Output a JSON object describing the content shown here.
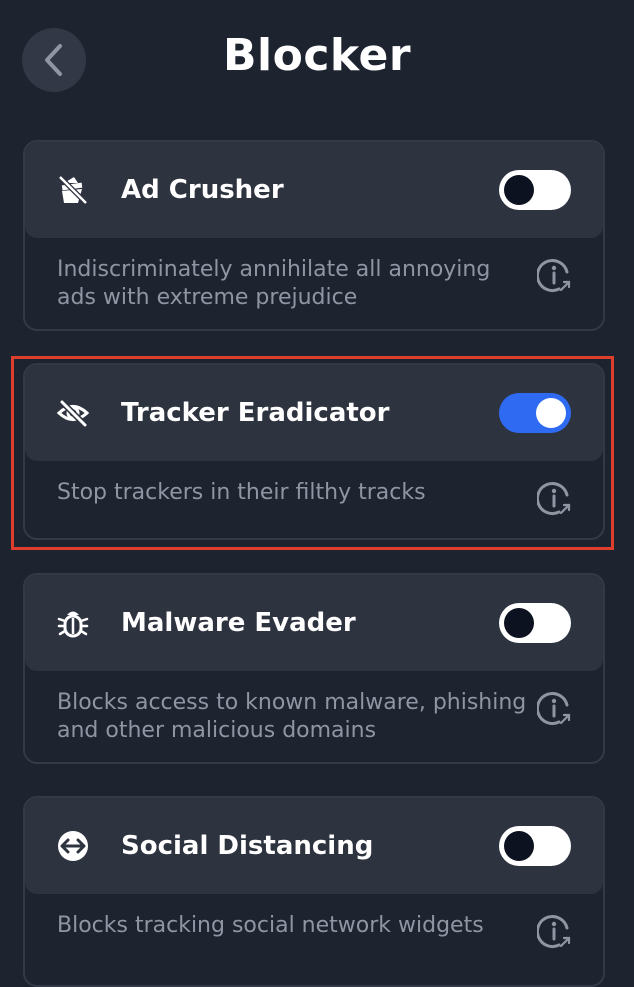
{
  "header": {
    "title": "Blocker",
    "back_icon": "chevron-left-icon"
  },
  "cards": [
    {
      "icon": "ad-crusher-icon",
      "title": "Ad Crusher",
      "description": "Indiscriminately annihilate all annoying ads with extreme prejudice",
      "enabled": false,
      "info_icon": "info-external-icon"
    },
    {
      "icon": "eye-slash-icon",
      "title": "Tracker Eradicator",
      "description": "Stop trackers in their filthy tracks",
      "enabled": true,
      "info_icon": "info-external-icon"
    },
    {
      "icon": "bug-icon",
      "title": "Malware Evader",
      "description": "Blocks access to known malware, phishing and other malicious domains",
      "enabled": false,
      "info_icon": "info-external-icon"
    },
    {
      "icon": "social-arrows-icon",
      "title": "Social Distancing",
      "description": "Blocks tracking social network widgets",
      "enabled": false,
      "info_icon": "info-external-icon"
    }
  ],
  "colors": {
    "background": "#1e2330",
    "card_header": "#2e3340",
    "toggle_on": "#2f6bf2",
    "highlight": "#e03e2d"
  }
}
